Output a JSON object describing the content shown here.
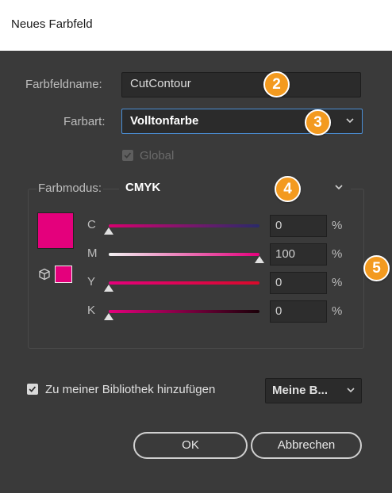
{
  "window": {
    "title": "Neues Farbfeld"
  },
  "form": {
    "name_label": "Farbfeldname:",
    "name_value": "CutContour",
    "type_label": "Farbart:",
    "type_value": "Volltonfarbe",
    "global_label": "Global",
    "global_checked": true,
    "global_enabled": false
  },
  "color_mode": {
    "label": "Farbmodus:",
    "value": "CMYK"
  },
  "channels": [
    {
      "label": "C",
      "value": "0",
      "unit": "%",
      "fraction": 0.0
    },
    {
      "label": "M",
      "value": "100",
      "unit": "%",
      "fraction": 1.0
    },
    {
      "label": "Y",
      "value": "0",
      "unit": "%",
      "fraction": 0.0
    },
    {
      "label": "K",
      "value": "0",
      "unit": "%",
      "fraction": 0.0
    }
  ],
  "swatch_color": "#e4007c",
  "library": {
    "label": "Zu meiner Bibliothek hinzufügen",
    "checked": true,
    "select_value": "Meine B..."
  },
  "buttons": {
    "ok": "OK",
    "cancel": "Abbrechen"
  },
  "badges": [
    "2",
    "3",
    "4",
    "5"
  ],
  "colors": {
    "badge": "#f39a1f",
    "dialog_bg": "#3a3a3a",
    "accent_border": "#4b8fd6"
  }
}
